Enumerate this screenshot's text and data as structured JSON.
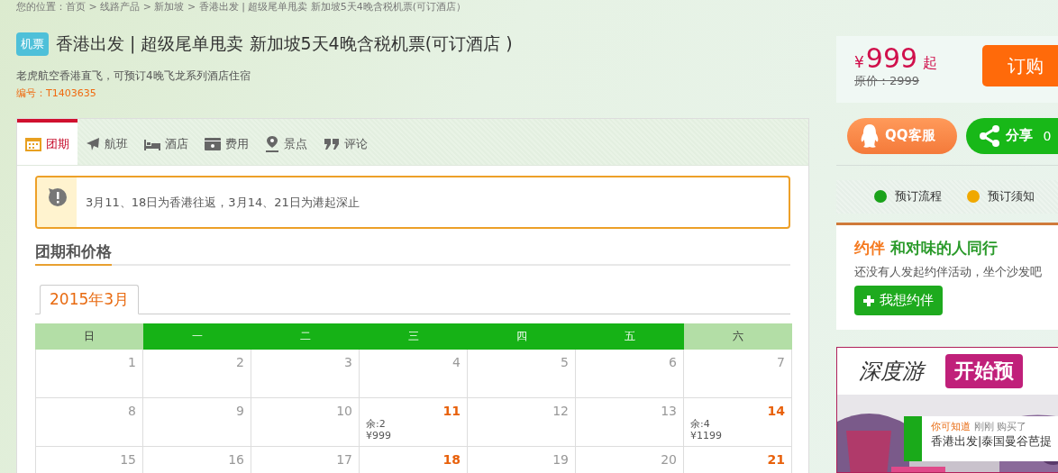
{
  "breadcrumb": "您的位置：首页  >  线路产品  >  新加坡  >  香港出发 | 超级尾单甩卖 新加坡5天4晚含税机票(可订酒店）",
  "product": {
    "badge": "机票",
    "title": "香港出发 | 超级尾单甩卖 新加坡5天4晚含税机票(可订酒店 )",
    "subtitle": "老虎航空香港直飞，可预订4晚飞龙系列酒店住宿",
    "code": "编号：T1403635"
  },
  "tabs": [
    {
      "label": "团期",
      "kind": "calendar",
      "selected": true
    },
    {
      "label": "航班",
      "kind": "plane",
      "selected": false
    },
    {
      "label": "酒店",
      "kind": "bed",
      "selected": false
    },
    {
      "label": "费用",
      "kind": "money",
      "selected": false
    },
    {
      "label": "景点",
      "kind": "pin",
      "selected": false
    },
    {
      "label": "评论",
      "kind": "quote",
      "selected": false
    }
  ],
  "notice": "3月11、18日为香港往返，3月14、21日为港起深止",
  "section_title": "团期和价格",
  "month_tab": "2015年3月",
  "weekdays": [
    {
      "label": "日",
      "weekend": true
    },
    {
      "label": "一",
      "weekend": false
    },
    {
      "label": "二",
      "weekend": false
    },
    {
      "label": "三",
      "weekend": false
    },
    {
      "label": "四",
      "weekend": false
    },
    {
      "label": "五",
      "weekend": false
    },
    {
      "label": "六",
      "weekend": true
    }
  ],
  "days": [
    {
      "day": "1",
      "available": false
    },
    {
      "day": "2",
      "available": false
    },
    {
      "day": "3",
      "available": false
    },
    {
      "day": "4",
      "available": false
    },
    {
      "day": "5",
      "available": false
    },
    {
      "day": "6",
      "available": false
    },
    {
      "day": "7",
      "available": false
    },
    {
      "day": "8",
      "available": false
    },
    {
      "day": "9",
      "available": false
    },
    {
      "day": "10",
      "available": false
    },
    {
      "day": "11",
      "available": true,
      "remaining": "余:2",
      "price": "¥999"
    },
    {
      "day": "12",
      "available": false
    },
    {
      "day": "13",
      "available": false
    },
    {
      "day": "14",
      "available": true,
      "remaining": "余:4",
      "price": "¥1199"
    },
    {
      "day": "15",
      "available": false
    },
    {
      "day": "16",
      "available": false
    },
    {
      "day": "17",
      "available": false
    },
    {
      "day": "18",
      "available": true
    },
    {
      "day": "19",
      "available": false
    },
    {
      "day": "20",
      "available": false
    },
    {
      "day": "21",
      "available": true
    }
  ],
  "price": {
    "currency": "¥",
    "amount": "999",
    "suffix": "起",
    "original": "原价：2999",
    "buy_button": "订购"
  },
  "actions": [
    {
      "label": "QQ客服",
      "kind": "qq"
    },
    {
      "label": "分享",
      "count": "0",
      "kind": "share"
    }
  ],
  "booking_links": [
    {
      "label": "预订流程",
      "color": "#1aa21a"
    },
    {
      "label": "预订须知",
      "color": "#f0a800"
    }
  ],
  "companion": {
    "logo": "约伴",
    "title": "和对味的人同行",
    "text": "还没有人发起约伴活动，坐个沙发吧",
    "button": "我想约伴"
  },
  "ad": {
    "logo": "深度游",
    "cta": "开始预",
    "ticker_label": "你可知道",
    "ticker_time": "刚刚",
    "ticker_action": "购买了",
    "ticker_item": "香港出发|泰国曼谷芭提"
  }
}
